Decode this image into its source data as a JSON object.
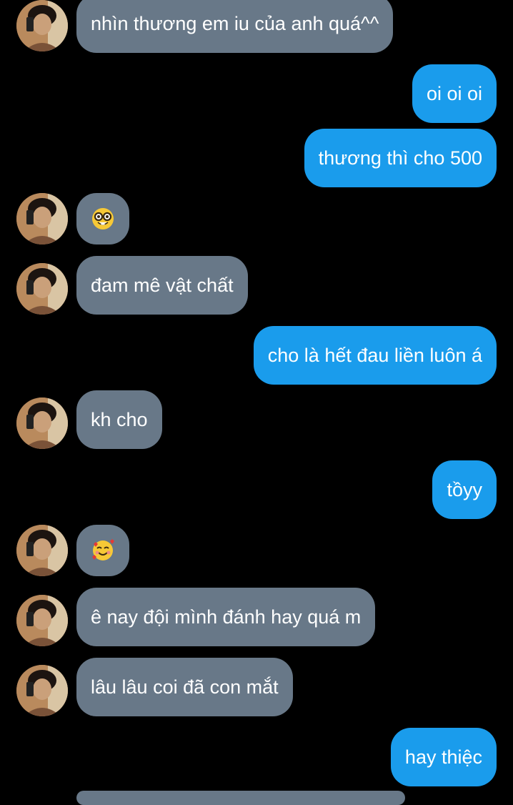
{
  "messages": [
    {
      "side": "received",
      "text": "nhìn thương em iu của anh quá^^"
    },
    {
      "side": "sent",
      "text": "oi oi oi"
    },
    {
      "side": "sent",
      "text": "thương thì cho 500"
    },
    {
      "side": "received",
      "emoji": "nerd-face"
    },
    {
      "side": "received",
      "text": "đam mê vật chất"
    },
    {
      "side": "sent",
      "text": "cho là hết đau liền luôn á"
    },
    {
      "side": "received",
      "text": "kh cho"
    },
    {
      "side": "sent",
      "text": "tồyy"
    },
    {
      "side": "received",
      "emoji": "smiling-face-with-hearts"
    },
    {
      "side": "received",
      "text": "ê nay đội mình đánh hay quá m"
    },
    {
      "side": "received",
      "text": "lâu lâu coi đã con mắt"
    },
    {
      "side": "sent",
      "text": "hay thiệc"
    }
  ],
  "colors": {
    "background": "#000000",
    "received_bubble": "#687888",
    "sent_bubble": "#1a9cec",
    "text": "#ffffff"
  }
}
